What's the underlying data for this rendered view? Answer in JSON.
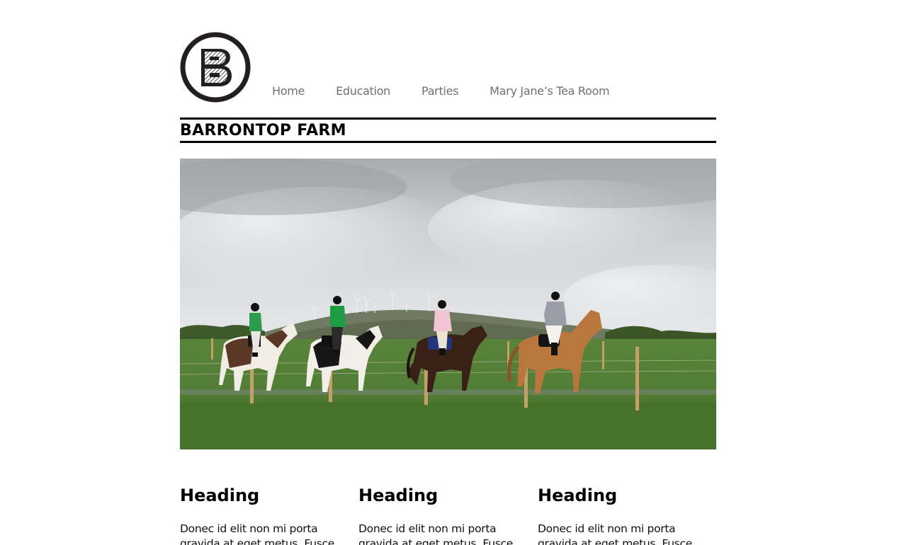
{
  "logo": {
    "letter": "B",
    "icon": "b-logo-icon"
  },
  "nav": {
    "items": [
      {
        "label": "Home"
      },
      {
        "label": "Education"
      },
      {
        "label": "Parties"
      },
      {
        "label": "Mary Jane’s Tea Room"
      }
    ]
  },
  "site": {
    "title": "BARRONTOP FARM"
  },
  "hero": {
    "image": "horse-riders-photo"
  },
  "columns": [
    {
      "heading": "Heading",
      "text": "Donec id elit non mi porta gravida at eget metus. Fusce"
    },
    {
      "heading": "Heading",
      "text": "Donec id elit non mi porta gravida at eget metus. Fusce"
    },
    {
      "heading": "Heading",
      "text": "Donec id elit non mi porta gravida at eget metus. Fusce"
    }
  ],
  "colors": {
    "text": "#000000",
    "nav": "#707070",
    "rule": "#000000"
  }
}
